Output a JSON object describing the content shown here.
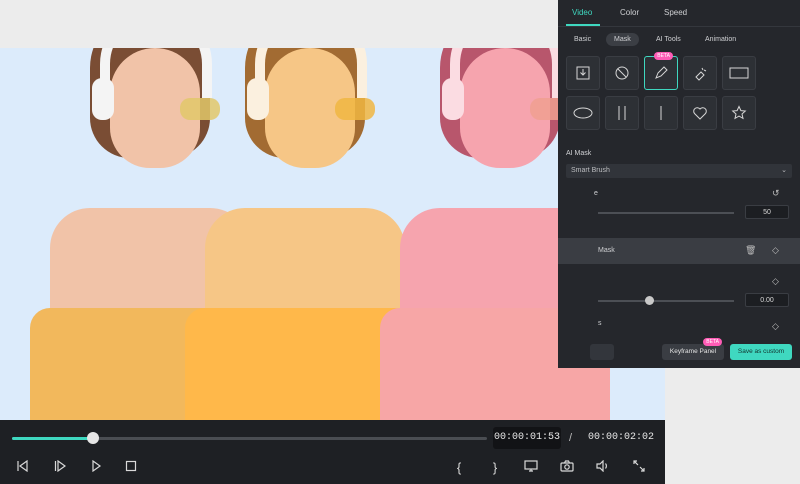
{
  "player": {
    "current_time": "00:00:01:53",
    "separator": "/",
    "total_time": "00:00:02:02",
    "progress": 0.17,
    "accent": "#3fd8c0"
  },
  "panel": {
    "tabs": [
      "Video",
      "Color",
      "Speed"
    ],
    "active_tab": "Video",
    "subtabs": [
      "Basic",
      "Mask",
      "AI Tools",
      "Animation"
    ],
    "active_subtab": "Mask",
    "beta_badge": "BETA",
    "ai_mask_label": "AI Mask",
    "smart_brush": "Smart Brush",
    "partial_label_1": "e",
    "value_1": "50",
    "mask_row_label": "Mask",
    "partial_label_2": "s",
    "value_2": "0.00",
    "keyframe_button": "Keyframe Panel",
    "keyframe_badge": "BETA",
    "save_button": "Save as custom"
  },
  "icons": {
    "tiles": [
      "import-icon",
      "no-mask-icon",
      "pen-icon",
      "ai-brush-icon",
      "rectangle-icon",
      "ellipse-icon",
      "double-line-icon",
      "single-line-icon",
      "heart-icon",
      "star-icon"
    ]
  }
}
